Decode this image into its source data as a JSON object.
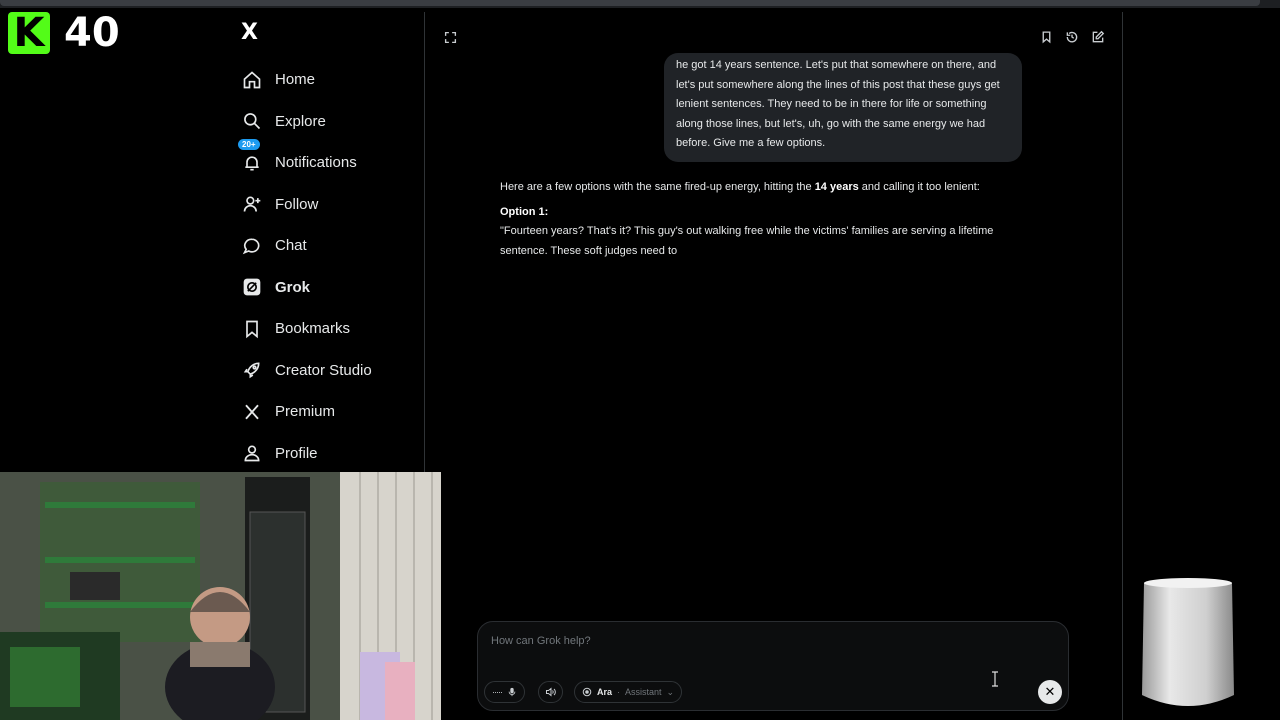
{
  "kick": {
    "logo": "K",
    "count": "40"
  },
  "sidebar": {
    "logo": "X",
    "items": [
      {
        "label": "Home",
        "icon": "home-icon"
      },
      {
        "label": "Explore",
        "icon": "search-icon"
      },
      {
        "label": "Notifications",
        "icon": "bell-icon",
        "badge": "20+"
      },
      {
        "label": "Follow",
        "icon": "add-person-icon"
      },
      {
        "label": "Chat",
        "icon": "chat-bubble-icon"
      },
      {
        "label": "Grok",
        "icon": "grok-icon",
        "active": true
      },
      {
        "label": "Bookmarks",
        "icon": "bookmark-icon"
      },
      {
        "label": "Creator Studio",
        "icon": "rocket-icon"
      },
      {
        "label": "Premium",
        "icon": "x-premium-icon"
      },
      {
        "label": "Profile",
        "icon": "profile-icon"
      }
    ]
  },
  "chat": {
    "user_message": "he got 14 years sentence. Let's put that somewhere on there, and let's put somewhere along the lines of this post that these guys get lenient sentences. They need to be in there for life or something along those lines, but let's, uh, go with the same energy we had before. Give me a few options.",
    "reply_intro_a": "Here are a few options with the same fired-up energy, hitting the ",
    "reply_intro_bold": "14 years",
    "reply_intro_b": " and calling it too lenient:",
    "option_label": "Option 1:",
    "option_text": "\"Fourteen years? That's it? This guy's out walking free while the victims' families are serving a lifetime sentence. These soft judges need to"
  },
  "composer": {
    "placeholder": "How can Grok help?",
    "voice_name": "Ara",
    "mode": "Assistant"
  },
  "colors": {
    "kick_green": "#53fc18",
    "badge_blue": "#1d9bf0",
    "bubble": "#202327"
  }
}
